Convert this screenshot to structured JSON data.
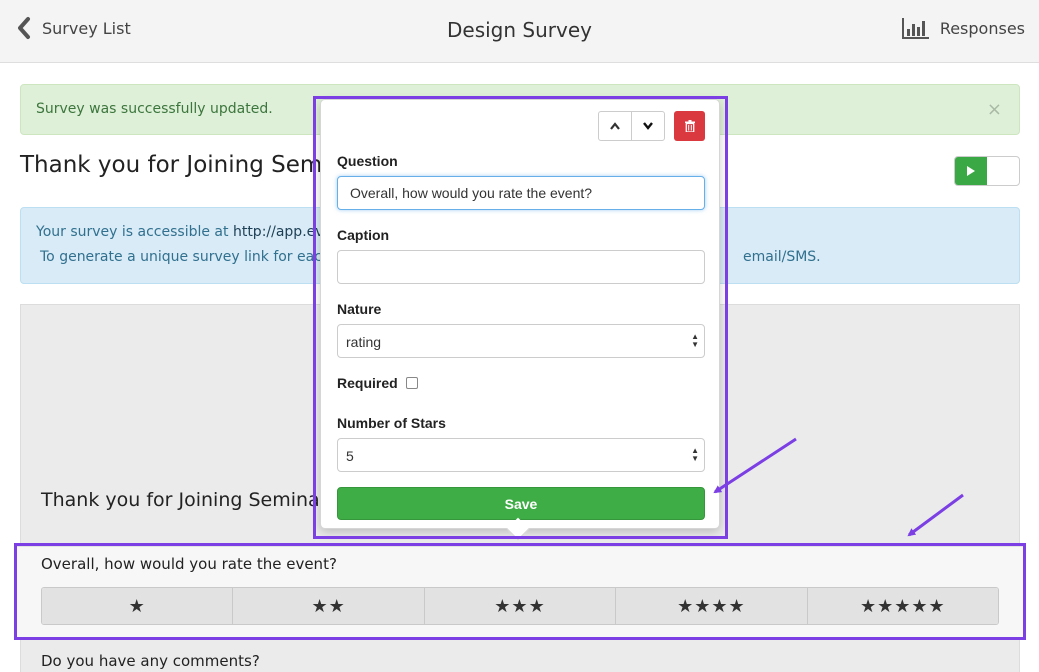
{
  "header": {
    "back_label": "Survey List",
    "title": "Design Survey",
    "responses_label": "Responses"
  },
  "alert": {
    "message": "Survey was successfully updated.",
    "close": "×"
  },
  "survey": {
    "title": "Thank you for Joining Sem"
  },
  "info": {
    "line1_prefix": "Your survey is accessible at ",
    "line1_url": "http://app.even",
    "line2": "To generate a unique survey link for each c",
    "line2_tail": "email/SMS."
  },
  "preview": {
    "title": "Thank you for Joining Semina",
    "question": "Overall, how would you rate the event?",
    "star_options": [
      "★",
      "★★",
      "★★★",
      "★★★★",
      "★★★★★"
    ],
    "next_question": "Do you have any comments?"
  },
  "editor": {
    "question_label": "Question",
    "question_value": "Overall, how would you rate the event?",
    "caption_label": "Caption",
    "caption_value": "",
    "nature_label": "Nature",
    "nature_value": "rating",
    "required_label": "Required",
    "required_checked": false,
    "stars_label": "Number of Stars",
    "stars_value": "5",
    "save_label": "Save"
  },
  "colors": {
    "annotation": "#7b3fe4",
    "save_button": "#3fad46",
    "delete_button": "#d9393f",
    "success_bg": "#dff0d8",
    "info_bg": "#d8ebf6"
  }
}
